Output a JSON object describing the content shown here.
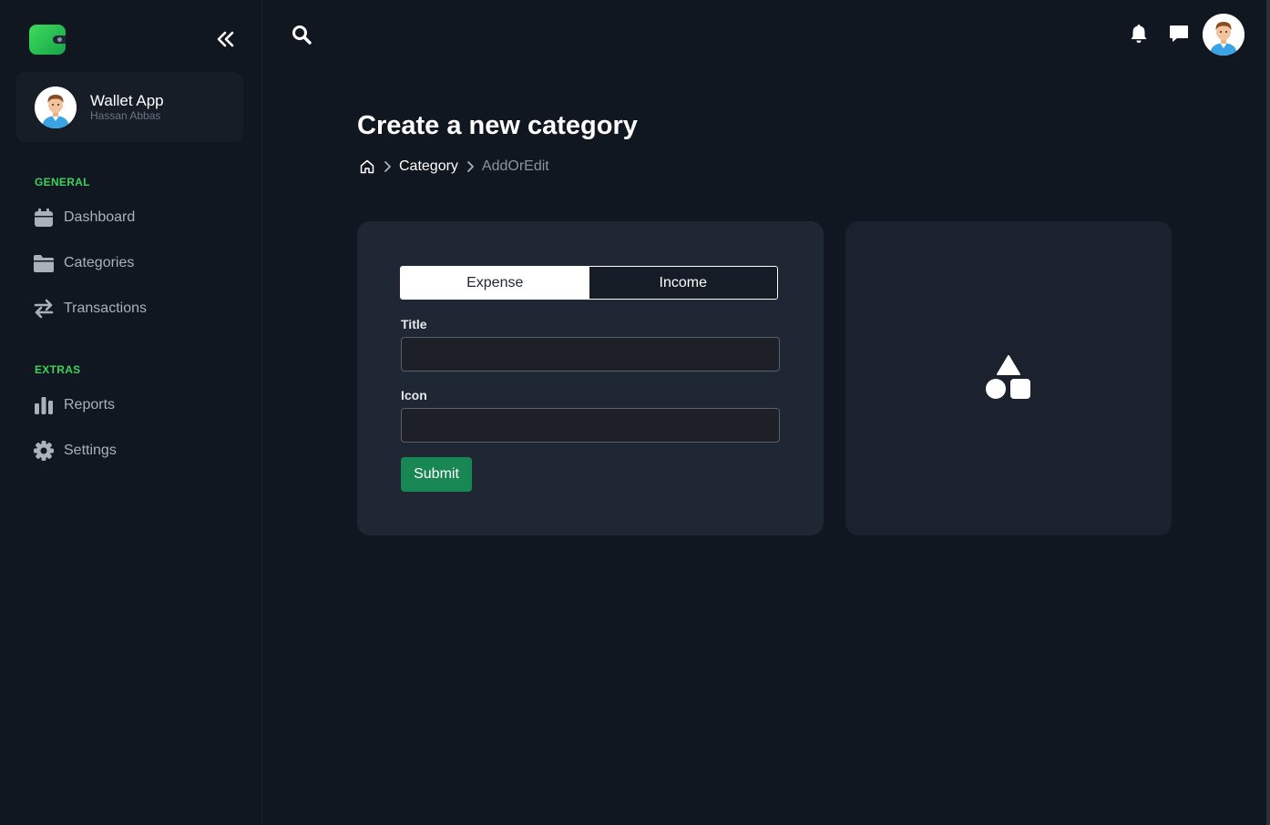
{
  "app": {
    "name": "Wallet App",
    "user": "Hassan Abbas"
  },
  "icons": {
    "logo": "wallet-logo-icon",
    "collapse": "double-chevron-left-icon",
    "search": "search-icon",
    "bell": "bell-icon",
    "chat": "chat-icon",
    "home": "home-icon",
    "preview": "shapes-icon"
  },
  "sidebar": {
    "sections": [
      {
        "label": "GENERAL",
        "items": [
          {
            "label": "Dashboard",
            "icon": "calendar-icon"
          },
          {
            "label": "Categories",
            "icon": "folder-icon"
          },
          {
            "label": "Transactions",
            "icon": "swap-arrows-icon"
          }
        ]
      },
      {
        "label": "EXTRAS",
        "items": [
          {
            "label": "Reports",
            "icon": "bar-chart-icon"
          },
          {
            "label": "Settings",
            "icon": "gear-icon"
          }
        ]
      }
    ]
  },
  "page": {
    "title": "Create a new category",
    "breadcrumb": {
      "link": "Category",
      "current": "AddOrEdit"
    }
  },
  "form": {
    "type_toggle": {
      "options": [
        "Expense",
        "Income"
      ],
      "selected": "Expense"
    },
    "title_label": "Title",
    "title_value": "",
    "icon_label": "Icon",
    "icon_value": "",
    "submit_label": "Submit"
  },
  "colors": {
    "accent": "#3fd15b",
    "submit": "#198754",
    "background": "#111720",
    "card": "#1e2733"
  }
}
